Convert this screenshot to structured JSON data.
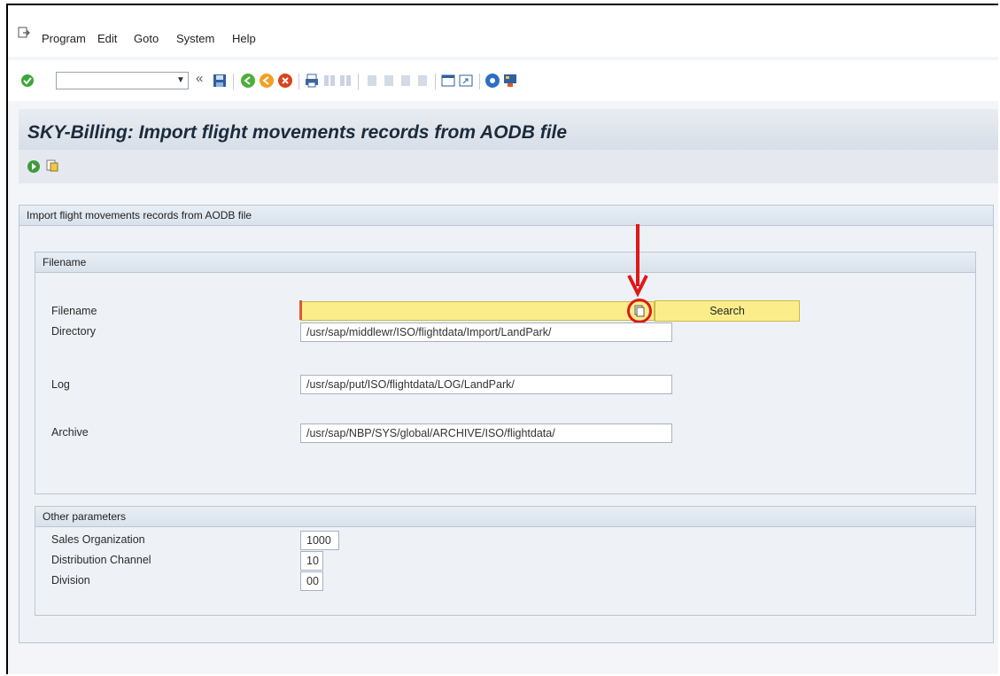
{
  "menu": {
    "items": [
      {
        "label": "Program"
      },
      {
        "label": "Edit"
      },
      {
        "label": "Goto"
      },
      {
        "label": "System"
      },
      {
        "label": "Help"
      }
    ]
  },
  "toolbar": {
    "command_field_value": "",
    "icons": [
      "check-icon",
      "back-arrows-icon",
      "save-icon",
      "back-icon",
      "exit-icon",
      "cancel-icon",
      "print-icon",
      "find-icon",
      "find-next-icon",
      "first-page-icon",
      "prev-page-icon",
      "next-page-icon",
      "last-page-icon",
      "new-session-icon",
      "shortcut-icon",
      "help-icon",
      "customize-layout-icon"
    ]
  },
  "page": {
    "title": "SKY-Billing: Import flight movements records from AODB file"
  },
  "app_toolbar": {
    "icons": [
      "execute-icon",
      "variant-icon"
    ]
  },
  "main_group": {
    "title": "Import flight movements records from AODB file"
  },
  "filename_group": {
    "title": "Filename",
    "fields": {
      "filename": {
        "label": "Filename",
        "value": ""
      },
      "directory": {
        "label": "Directory",
        "value": "/usr/sap/middlewr/ISO/flightdata/Import/LandPark/"
      },
      "log": {
        "label": "Log",
        "value": "/usr/sap/put/ISO/flightdata/LOG/LandPark/"
      },
      "archive": {
        "label": "Archive",
        "value": "/usr/sap/NBP/SYS/global/ARCHIVE/ISO/flightdata/"
      }
    },
    "search_label": "Search"
  },
  "other_group": {
    "title": "Other parameters",
    "fields": {
      "sales_org": {
        "label": "Sales Organization",
        "value": "1000"
      },
      "dist_channel": {
        "label": "Distribution Channel",
        "value": "10"
      },
      "division": {
        "label": "Division",
        "value": "00"
      }
    }
  },
  "colors": {
    "required_field": "#fbee8a",
    "annotation": "#e01818",
    "title_text": "#1c2a3a"
  }
}
